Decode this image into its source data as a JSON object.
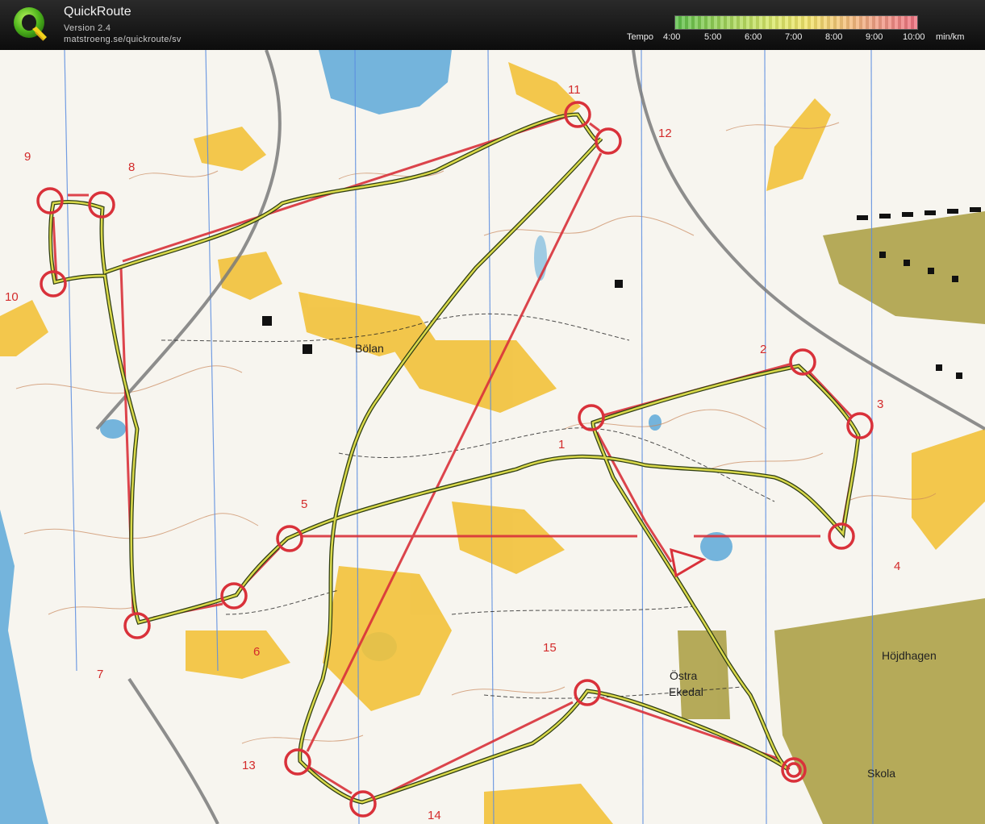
{
  "header": {
    "title": "QuickRoute",
    "version": "Version 2.4",
    "url": "matstroeng.se/quickroute/sv",
    "logo_letter": "Q",
    "logo_icon": "quickroute-logo-icon"
  },
  "legend": {
    "label": "Tempo",
    "ticks": [
      "4:00",
      "5:00",
      "6:00",
      "7:00",
      "8:00",
      "9:00",
      "10:00"
    ],
    "unit": "min/km",
    "colors": [
      "#5cbf4a",
      "#9fd45a",
      "#d9e86a",
      "#f2e36a",
      "#f4c27a",
      "#f19a86",
      "#ee6f7f"
    ]
  },
  "map": {
    "place_names": [
      "Bölan",
      "Höjdhagen",
      "Östra",
      "Ekedal",
      "Skola"
    ],
    "control_numbers": [
      "1",
      "2",
      "3",
      "4",
      "5",
      "6",
      "7",
      "8",
      "9",
      "10",
      "11",
      "12",
      "13",
      "14",
      "15"
    ],
    "colors": {
      "course": "#d9313a",
      "route": "#d9d94a",
      "route_edge": "#2f3d14",
      "paper": "#f8f6f0",
      "forest_open": "#f2c23a",
      "water": "#6fb2dc",
      "contour": "#c9875b",
      "urban": "#a89a3d"
    }
  }
}
